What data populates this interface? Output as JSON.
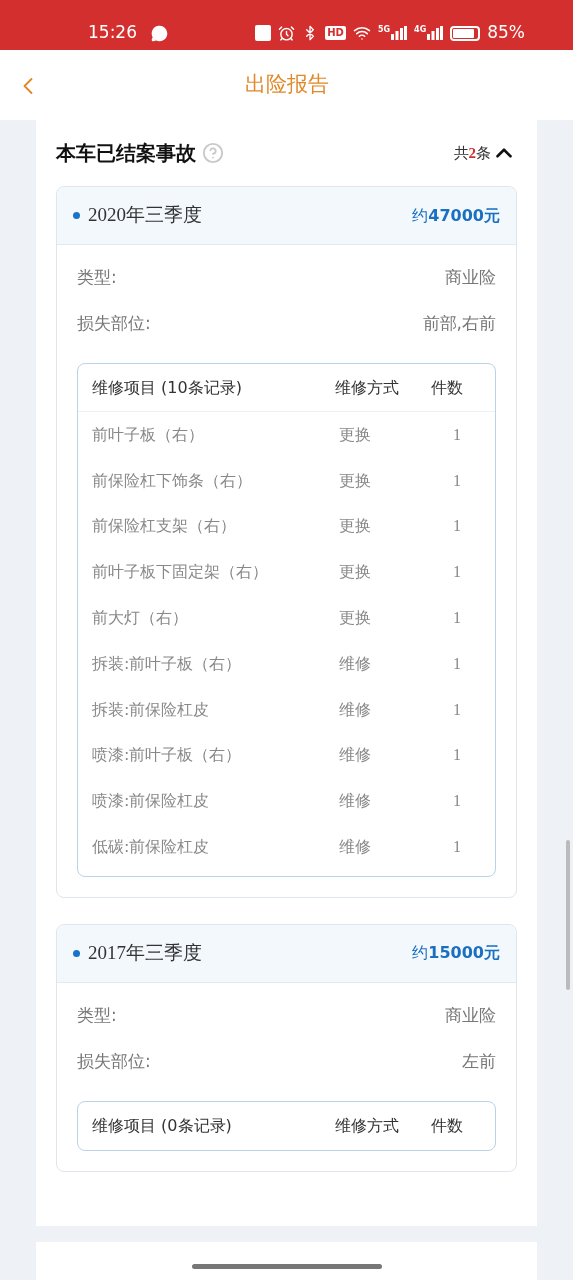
{
  "status_bar": {
    "time": "15:26",
    "hd": "HD",
    "net_5g": "5G",
    "net_4g": "4G",
    "battery": "85%"
  },
  "nav": {
    "title": "出险报告"
  },
  "section": {
    "title": "本车已结案事故",
    "count_prefix": "共",
    "count": "2",
    "count_suffix": "条",
    "expanded": true
  },
  "accidents": [
    {
      "period": "2020年三季度",
      "amount": "约**47000元**",
      "fields": [
        {
          "label": "类型:",
          "value": "商业险"
        },
        {
          "label": "损失部位:",
          "value": "前部,右前"
        }
      ],
      "table": {
        "columns": [
          "维修项目 (10条记录)",
          "维修方式",
          "件数"
        ],
        "rows": [
          [
            "前叶子板（右）",
            "更换",
            "1"
          ],
          [
            "前保险杠下饰条（右）",
            "更换",
            "1"
          ],
          [
            "前保险杠支架（右）",
            "更换",
            "1"
          ],
          [
            "前叶子板下固定架（右）",
            "更换",
            "1"
          ],
          [
            "前大灯（右）",
            "更换",
            "1"
          ],
          [
            "拆装:前叶子板（右）",
            "维修",
            "1"
          ],
          [
            "拆装:前保险杠皮",
            "维修",
            "1"
          ],
          [
            "喷漆:前叶子板（右）",
            "维修",
            "1"
          ],
          [
            "喷漆:前保险杠皮",
            "维修",
            "1"
          ],
          [
            "低碳:前保险杠皮",
            "维修",
            "1"
          ]
        ]
      }
    },
    {
      "period": "2017年三季度",
      "amount": "约**15000元**",
      "fields": [
        {
          "label": "类型:",
          "value": "商业险"
        },
        {
          "label": "损失部位:",
          "value": "左前"
        }
      ],
      "table": {
        "columns": [
          "维修项目 (0条记录)",
          "维修方式",
          "件数"
        ]
      }
    }
  ]
}
